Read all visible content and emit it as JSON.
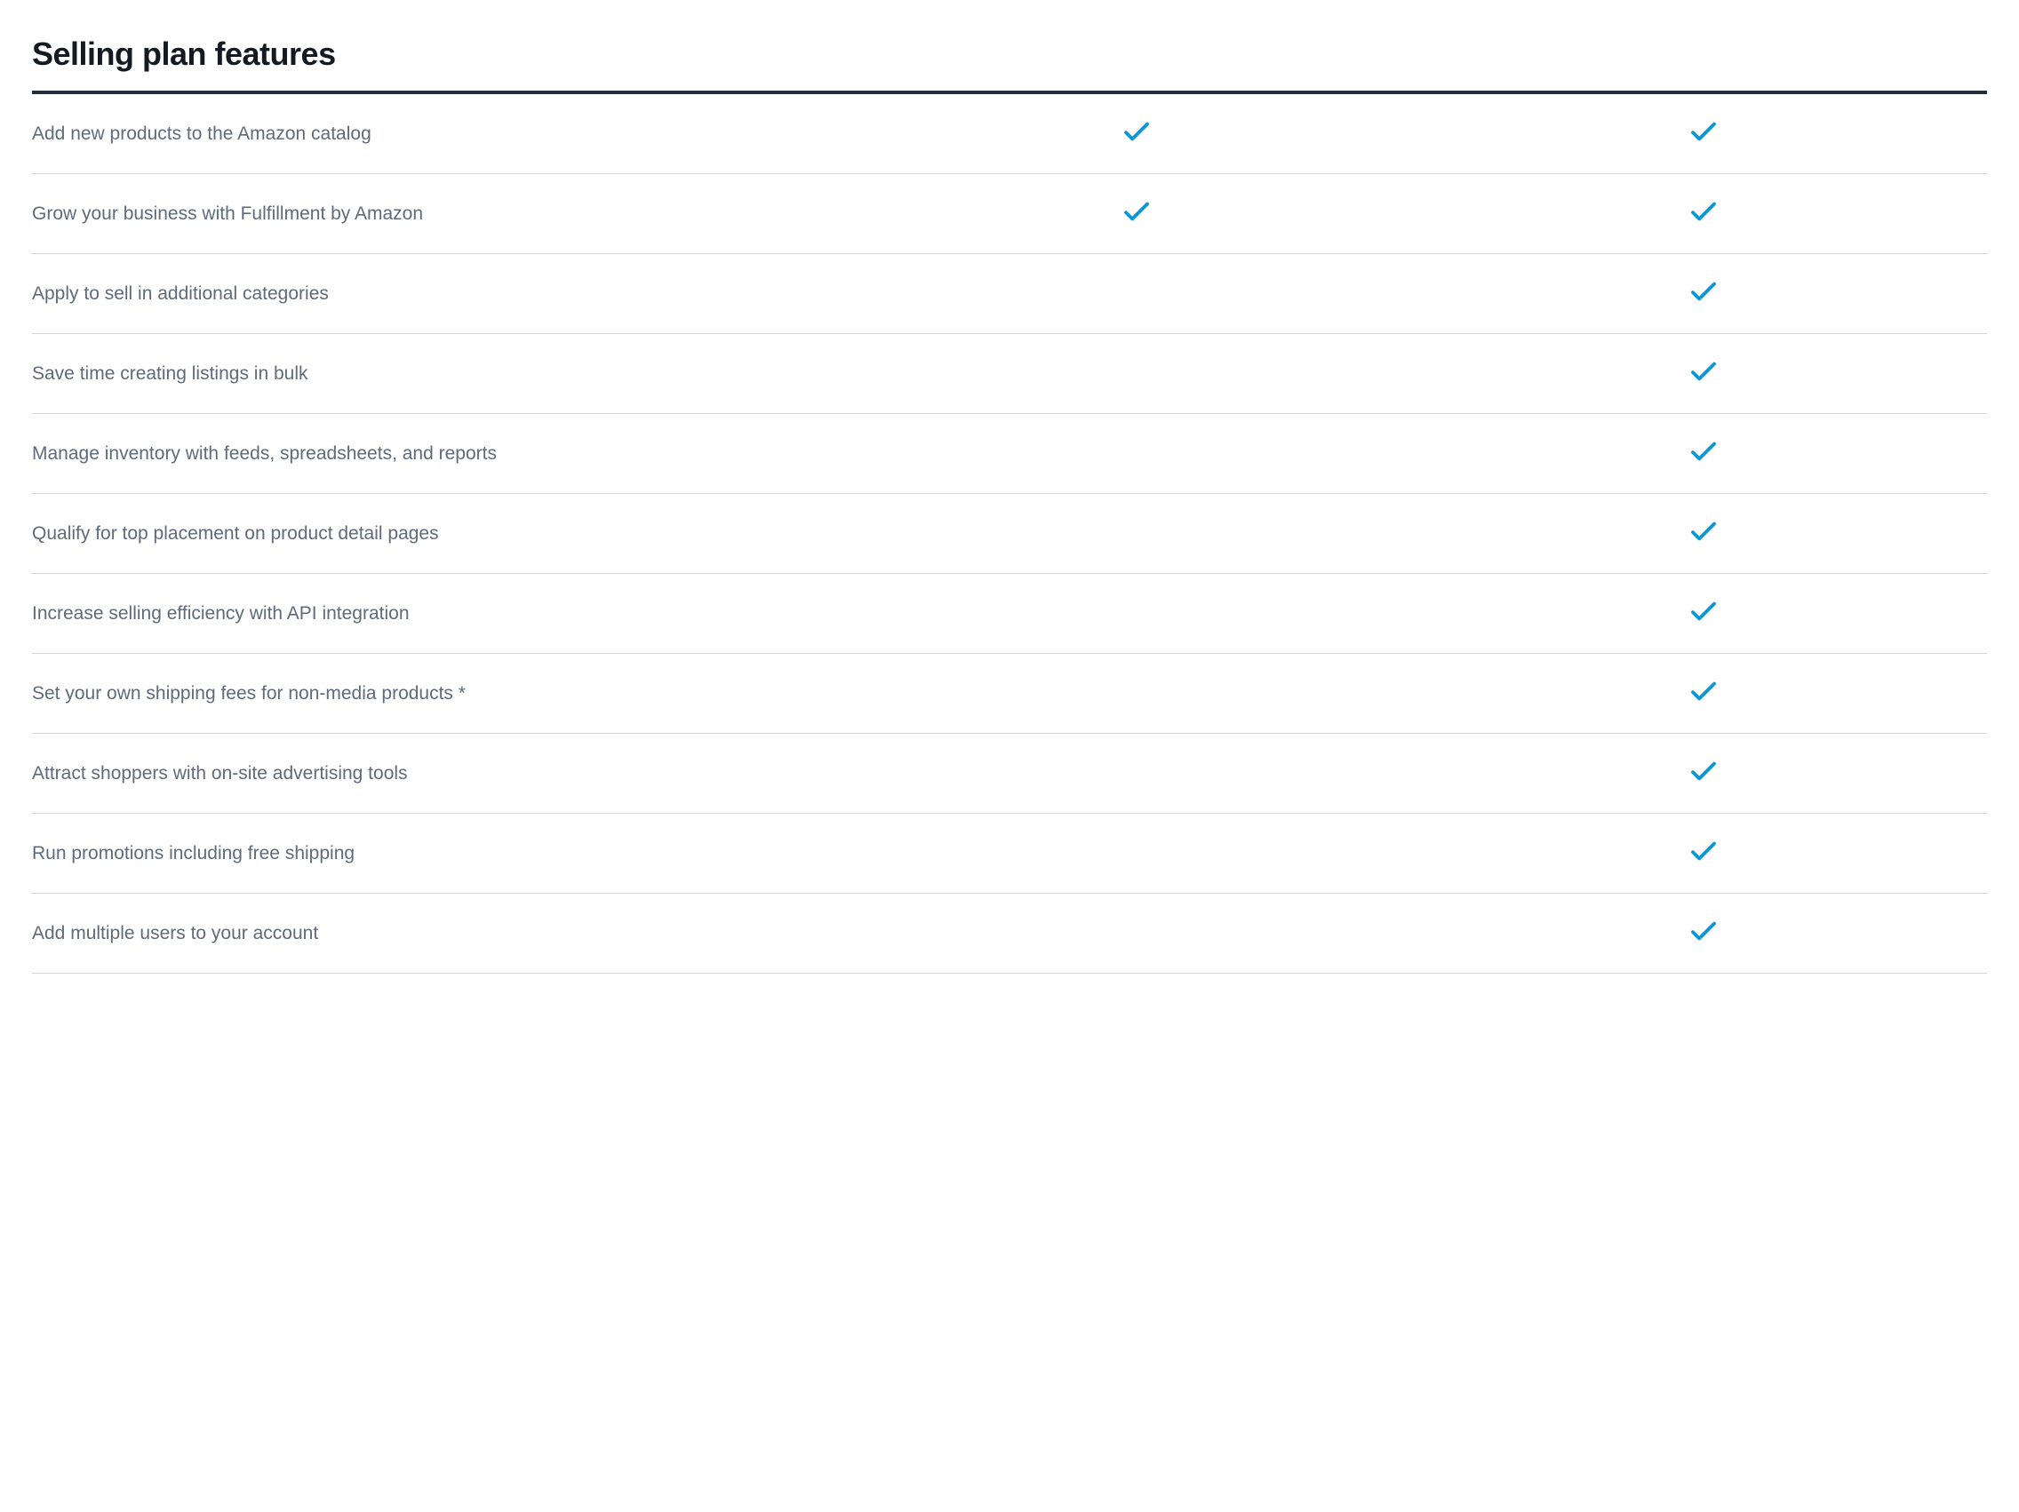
{
  "section": {
    "title": "Selling plan features"
  },
  "features": [
    {
      "label": "Add new products to the Amazon catalog",
      "col1": true,
      "col2": true
    },
    {
      "label": "Grow your business with Fulfillment by Amazon",
      "col1": true,
      "col2": true
    },
    {
      "label": "Apply to sell in additional categories",
      "col1": false,
      "col2": true
    },
    {
      "label": "Save time creating listings in bulk",
      "col1": false,
      "col2": true
    },
    {
      "label": "Manage inventory with feeds, spreadsheets, and reports",
      "col1": false,
      "col2": true
    },
    {
      "label": "Qualify for top placement on product detail pages",
      "col1": false,
      "col2": true
    },
    {
      "label": "Increase selling efficiency with API integration",
      "col1": false,
      "col2": true
    },
    {
      "label": "Set your own shipping fees for non-media products *",
      "col1": false,
      "col2": true
    },
    {
      "label": "Attract shoppers with on-site advertising tools",
      "col1": false,
      "col2": true
    },
    {
      "label": "Run promotions including free shipping",
      "col1": false,
      "col2": true
    },
    {
      "label": "Add multiple users to your account",
      "col1": false,
      "col2": true
    }
  ],
  "colors": {
    "check": "#0d96d6"
  }
}
